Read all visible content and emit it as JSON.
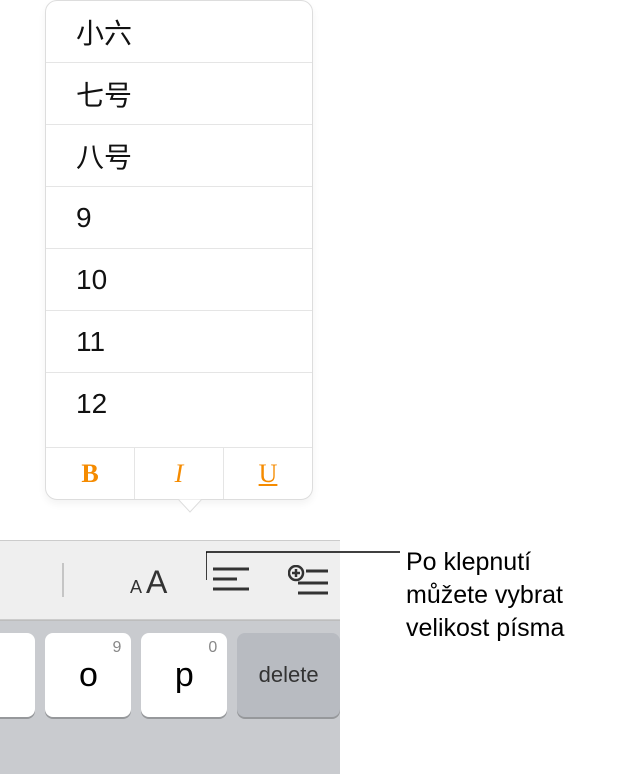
{
  "popover": {
    "sizes": [
      "小六",
      "七号",
      "八号",
      "9",
      "10",
      "11",
      "12"
    ],
    "bold_label": "B",
    "italic_label": "I",
    "underline_label": "U"
  },
  "callout": {
    "line1": "Po klepnutí",
    "line2": "můžete vybrat",
    "line3": "velikost písma"
  },
  "keyboard": {
    "key1_main": "o",
    "key1_hint": "9",
    "key2_main": "p",
    "key2_hint": "0",
    "delete_label": "delete"
  }
}
